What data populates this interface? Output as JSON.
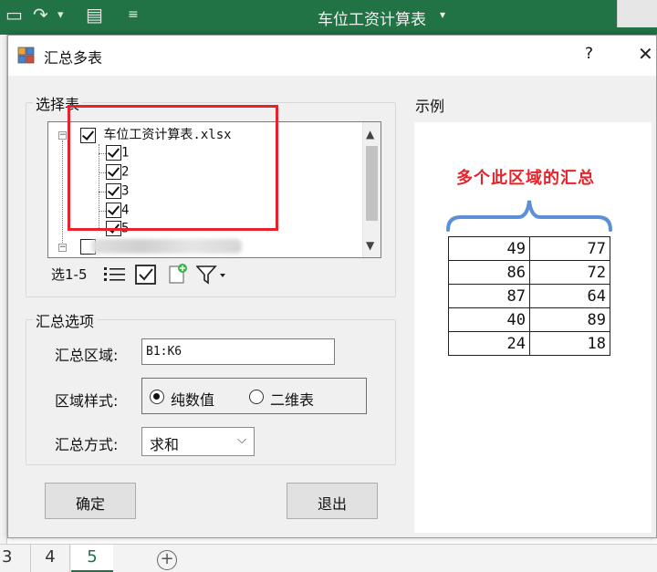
{
  "excel": {
    "title": "车位工资计算表",
    "title_caret": "▾",
    "sheet_tabs": [
      "3",
      "4",
      "5"
    ],
    "active_tab": "5",
    "add_sheet": "+"
  },
  "dialog": {
    "title": "汇总多表",
    "help": "?",
    "close": "✕",
    "select_group": {
      "label": "选择表",
      "file_name": "车位工资计算表.xlsx",
      "items": [
        "1",
        "2",
        "3",
        "4",
        "5"
      ],
      "toolbar": {
        "select_range": "选1-5"
      }
    },
    "options_group": {
      "label": "汇总选项",
      "range_label": "汇总区域:",
      "range_value": "B1:K6",
      "style_label": "区域样式:",
      "style_options": [
        "纯数值",
        "二维表"
      ],
      "style_selected": "纯数值",
      "method_label": "汇总方式:",
      "method_value": "求和"
    },
    "buttons": {
      "ok": "确定",
      "exit": "退出"
    },
    "example": {
      "label": "示例",
      "caption": "多个此区域的汇总",
      "table": [
        [
          "49",
          "77"
        ],
        [
          "86",
          "72"
        ],
        [
          "87",
          "64"
        ],
        [
          "40",
          "89"
        ],
        [
          "24",
          "18"
        ]
      ]
    }
  },
  "colors": {
    "excel_green": "#217346",
    "highlight_red": "#e8222a",
    "bracket_blue": "#5b8fd6"
  }
}
